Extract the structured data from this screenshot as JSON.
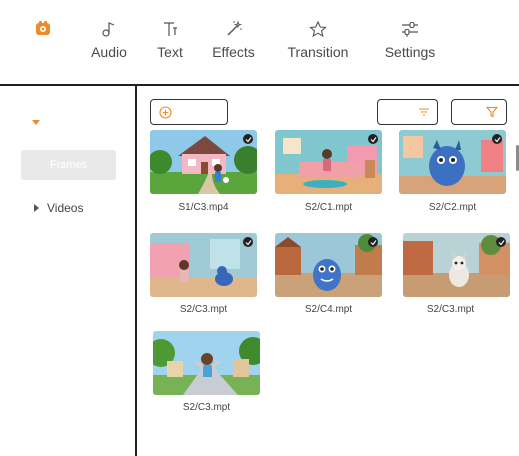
{
  "toolbar": {
    "logo_icon": "camera-app-logo-icon",
    "items": [
      {
        "label": "Audio",
        "icon": "music-note-icon"
      },
      {
        "label": "Text",
        "icon": "text-icon"
      },
      {
        "label": "Effects",
        "icon": "magic-wand-icon"
      },
      {
        "label": "Transition",
        "icon": "star-outline-icon"
      },
      {
        "label": "Settings",
        "icon": "sliders-icon"
      }
    ]
  },
  "sidebar": {
    "frames_label": "Frames",
    "videos_label": "Videos"
  },
  "media": {
    "items": [
      {
        "caption": "S1/C3.mp4",
        "checked": true
      },
      {
        "caption": "S2/C1.mpt",
        "checked": true
      },
      {
        "caption": "S2/C2.mpt",
        "checked": true
      },
      {
        "caption": "S2/C3.mpt",
        "checked": true
      },
      {
        "caption": "S2/C4.mpt",
        "checked": true
      },
      {
        "caption": "S2/C3.mpt",
        "checked": true
      },
      {
        "caption": "S2/C3.mpt",
        "checked": false
      }
    ]
  },
  "colors": {
    "accent": "#f08a24",
    "divider": "#1f1f1f"
  }
}
